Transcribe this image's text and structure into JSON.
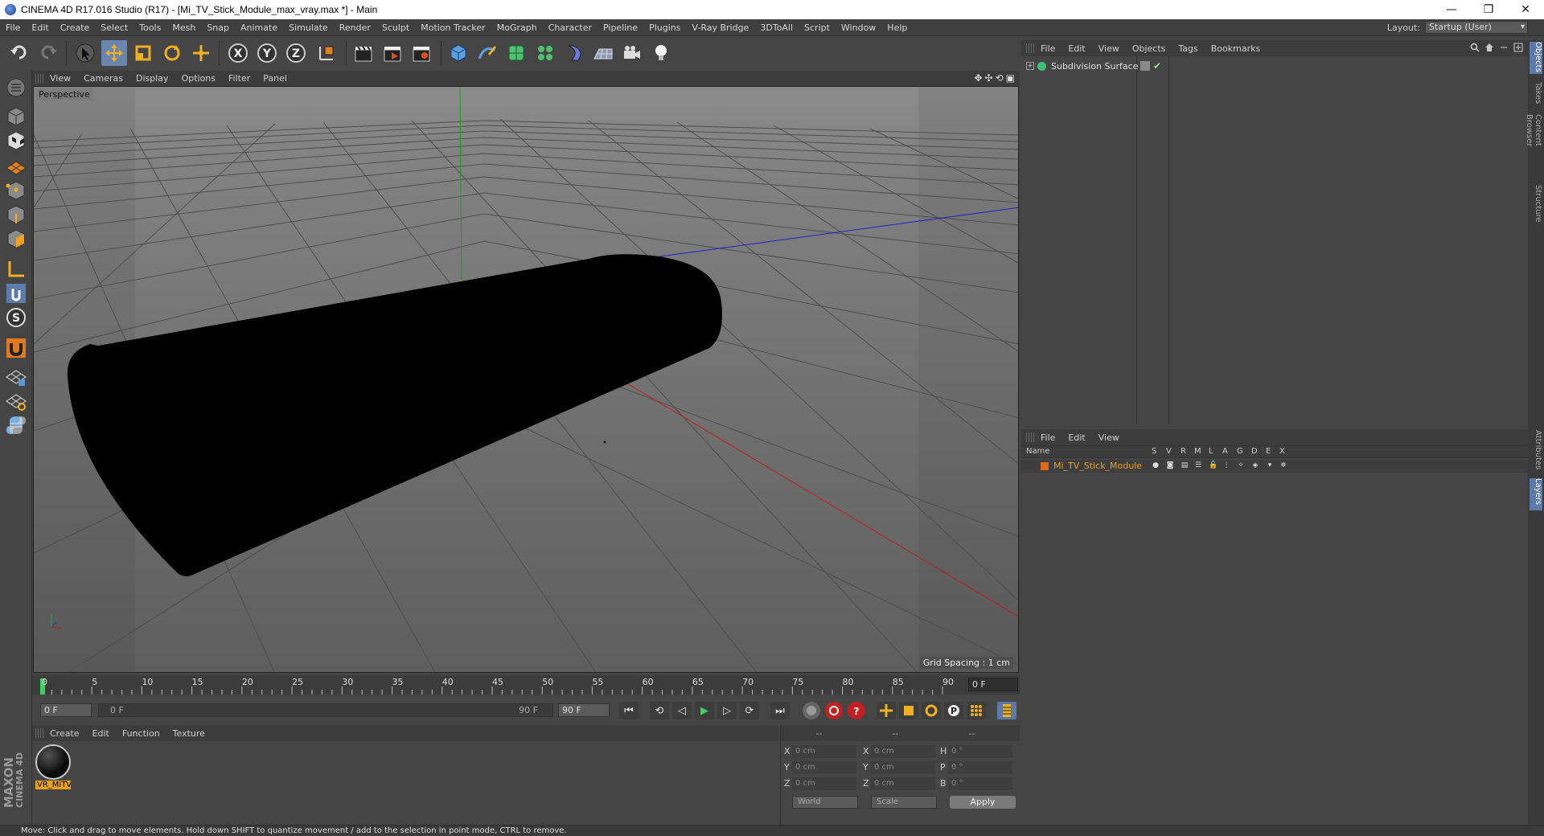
{
  "window": {
    "title": "CINEMA 4D R17.016 Studio (R17) - [Mi_TV_Stick_Module_max_vray.max *] - Main",
    "minimize": "—",
    "maximize": "❐",
    "close": "✕"
  },
  "menu": [
    "File",
    "Edit",
    "Create",
    "Select",
    "Tools",
    "Mesh",
    "Snap",
    "Animate",
    "Simulate",
    "Render",
    "Sculpt",
    "Motion Tracker",
    "MoGraph",
    "Character",
    "Pipeline",
    "Plugins",
    "V-Ray Bridge",
    "3DToAll",
    "Script",
    "Window",
    "Help"
  ],
  "layout": {
    "label": "Layout:",
    "value": "Startup (User)"
  },
  "toolbar_axes": [
    "X",
    "Y",
    "Z"
  ],
  "viewport": {
    "menu": [
      "View",
      "Cameras",
      "Display",
      "Options",
      "Filter",
      "Panel"
    ],
    "camera_label": "Perspective",
    "grid_spacing": "Grid Spacing : 1 cm",
    "nav_icons": [
      "✥",
      "✣",
      "⟲",
      "▣"
    ]
  },
  "timeline": {
    "ticks": [
      "0",
      "5",
      "10",
      "15",
      "20",
      "25",
      "30",
      "35",
      "40",
      "45",
      "50",
      "55",
      "60",
      "65",
      "70",
      "75",
      "80",
      "85",
      "90"
    ],
    "current_frame": "0 F"
  },
  "transport": {
    "start_field": "0 F",
    "range_start": "0 F",
    "range_end": "90 F",
    "end_field": "90 F",
    "buttons": [
      "⏮",
      "⟲",
      "◁",
      "▶",
      "▷",
      "⟳",
      "⏭"
    ]
  },
  "materials": {
    "menu": [
      "Create",
      "Edit",
      "Function",
      "Texture"
    ],
    "items": [
      {
        "name": "VR_MiTV"
      }
    ]
  },
  "coordinates": {
    "headers": [
      "--",
      "--",
      "--"
    ],
    "rows": [
      {
        "a": "X",
        "av": "0 cm",
        "b": "X",
        "bv": "0 cm",
        "c": "H",
        "cv": "0 °"
      },
      {
        "a": "Y",
        "av": "0 cm",
        "b": "Y",
        "bv": "0 cm",
        "c": "P",
        "cv": "0 °"
      },
      {
        "a": "Z",
        "av": "0 cm",
        "b": "Z",
        "bv": "0 cm",
        "c": "B",
        "cv": "0 °"
      }
    ],
    "mode": "World",
    "scale": "Scale",
    "apply": "Apply"
  },
  "status": "Move: Click and drag to move elements. Hold down SHIFT to quantize movement / add to the selection in point mode, CTRL to remove.",
  "maxon": {
    "brand": "MAXON",
    "product": "CINEMA 4D"
  },
  "objects": {
    "menu": [
      "File",
      "Edit",
      "View",
      "Objects",
      "Tags",
      "Bookmarks"
    ],
    "items": [
      {
        "name": "Subdivision Surface",
        "check": "✔"
      }
    ]
  },
  "right_tabs": [
    "Objects",
    "Takes",
    "Content Browser",
    "Structure",
    "Attributes",
    "Layers"
  ],
  "layers": {
    "menu": [
      "File",
      "Edit",
      "View"
    ],
    "columns": [
      "Name",
      "S",
      "V",
      "R",
      "M",
      "L",
      "A",
      "G",
      "D",
      "E",
      "X"
    ],
    "items": [
      {
        "name": "Mi_TV_Stick_Module",
        "color": "#e06a1c"
      }
    ]
  }
}
